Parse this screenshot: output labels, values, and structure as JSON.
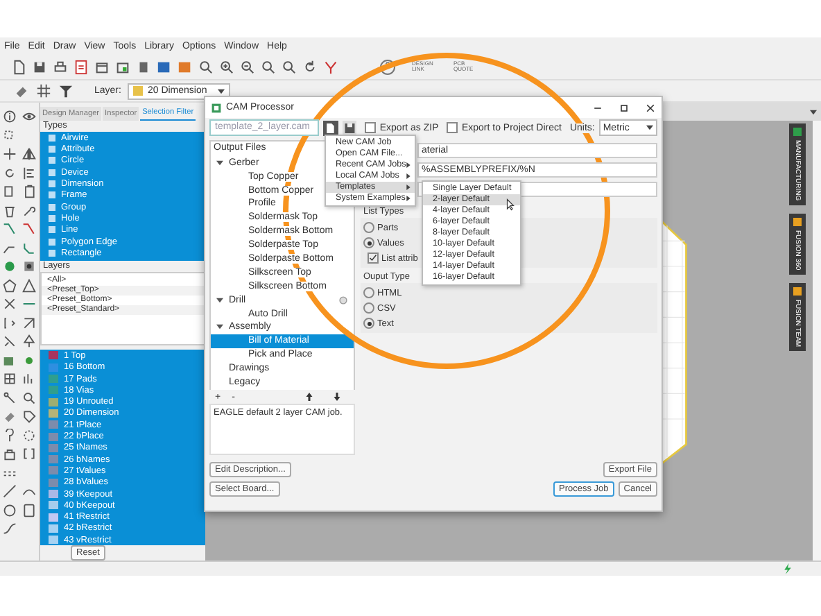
{
  "menu_bar": [
    "File",
    "Edit",
    "Draw",
    "View",
    "Tools",
    "Library",
    "Options",
    "Window",
    "Help"
  ],
  "toolbar": {
    "help": "?",
    "links": [
      "DESIGN LINK",
      "PCB QUOTE"
    ]
  },
  "layer_picker": {
    "label": "Layer:",
    "value": "20 Dimension"
  },
  "panel_tabs": [
    {
      "label": "Design Manager",
      "selected": false
    },
    {
      "label": "Inspector",
      "selected": false
    },
    {
      "label": "Selection Filter",
      "selected": true
    }
  ],
  "selection_filter": {
    "types_header": "Types",
    "types": [
      "Airwire",
      "Attribute",
      "Circle",
      "Device",
      "Dimension",
      "Frame",
      "Group",
      "Hole",
      "Line",
      "Polygon Edge",
      "Rectangle"
    ],
    "layers_header": "Layers",
    "presets": [
      "<All>",
      "<Preset_Top>",
      "<Preset_Bottom>",
      "<Preset_Standard>"
    ],
    "layers": [
      {
        "label": "1 Top",
        "color": "#a8345e"
      },
      {
        "label": "16 Bottom",
        "color": "#2e8fe0"
      },
      {
        "label": "17 Pads",
        "color": "#2f9e8e"
      },
      {
        "label": "18 Vias",
        "color": "#2f9e8e"
      },
      {
        "label": "19 Unrouted",
        "color": "#9cae72"
      },
      {
        "label": "20 Dimension",
        "color": "#b4b478"
      },
      {
        "label": "21 tPlace",
        "color": "#7c8cac"
      },
      {
        "label": "22 bPlace",
        "color": "#7c8cac"
      },
      {
        "label": "25 tNames",
        "color": "#7c8cac"
      },
      {
        "label": "26 bNames",
        "color": "#7c8cac"
      },
      {
        "label": "27 tValues",
        "color": "#7c8cac"
      },
      {
        "label": "28 bValues",
        "color": "#7c8cac"
      },
      {
        "label": "39 tKeepout",
        "color": "#aab8e6"
      },
      {
        "label": "40 bKeepout",
        "color": "#a6cdec"
      },
      {
        "label": "41 tRestrict",
        "color": "#c2c8f2"
      },
      {
        "label": "42 bRestrict",
        "color": "#a6d2f2"
      },
      {
        "label": "43 vRestrict",
        "color": "#a6d2f2"
      }
    ]
  },
  "reset_button": "Reset",
  "side_tabs": [
    {
      "label": "MANUFACTURING",
      "color": "#2e9e4a"
    },
    {
      "label": "FUSION 360",
      "color": "#e8a020"
    },
    {
      "label": "FUSION TEAM",
      "color": "#e8a020"
    }
  ],
  "cam_dialog": {
    "title": "CAM Processor",
    "job_file": "template_2_layer.cam",
    "export_zip": {
      "label": "Export as ZIP",
      "checked": false
    },
    "export_project": {
      "label": "Export to Project Direct",
      "checked": false
    },
    "units_label": "Units:",
    "units_value": "Metric",
    "tree_header": "Output Files",
    "tree": [
      {
        "label": "Gerber",
        "expanded": true,
        "selected": false,
        "children": [
          {
            "label": "Top Copper",
            "selected": false
          },
          {
            "label": "Bottom Copper",
            "selected": false
          },
          {
            "label": "Profile",
            "selected": false
          },
          {
            "label": "Soldermask Top",
            "selected": false
          },
          {
            "label": "Soldermask Bottom",
            "selected": false
          },
          {
            "label": "Solderpaste Top",
            "selected": false
          },
          {
            "label": "Solderpaste Bottom",
            "selected": false
          },
          {
            "label": "Silkscreen Top",
            "selected": false
          },
          {
            "label": "Silkscreen Bottom",
            "selected": false
          }
        ]
      },
      {
        "label": "Drill",
        "expanded": true,
        "selected": false,
        "children": [
          {
            "label": "Auto Drill",
            "selected": false
          }
        ]
      },
      {
        "label": "Assembly",
        "expanded": true,
        "selected": false,
        "children": [
          {
            "label": "Bill of Material",
            "selected": true
          },
          {
            "label": "Pick and Place",
            "selected": false
          }
        ]
      },
      {
        "label": "Drawings",
        "selected": false
      },
      {
        "label": "Legacy",
        "selected": false
      }
    ],
    "add_label": "+",
    "remove_label": "-",
    "description": "EAGLE default 2 layer CAM job.",
    "edit_description": "Edit Description...",
    "select_board": "Select Board...",
    "fields": [
      "aterial",
      "%ASSEMBLYPREFIX/%N"
    ],
    "list_types": {
      "title": "List Types",
      "options": [
        {
          "label": "Parts",
          "selected": false
        },
        {
          "label": "Values",
          "selected": true
        }
      ]
    },
    "list_attributes": {
      "label": "List attrib",
      "checked": true
    },
    "output_type": {
      "title": "Ouput Type",
      "options": [
        {
          "label": "HTML",
          "selected": false
        },
        {
          "label": "CSV",
          "selected": false
        },
        {
          "label": "Text",
          "selected": true
        }
      ]
    },
    "export_file": "Export File",
    "process_job": "Process Job",
    "cancel": "Cancel",
    "job_menu": [
      {
        "label": "New CAM Job",
        "submenu": false,
        "selected": false
      },
      {
        "label": "Open CAM File...",
        "submenu": false,
        "selected": false
      },
      {
        "label": "Recent CAM Jobs",
        "submenu": true,
        "selected": false
      },
      {
        "label": "Local CAM Jobs",
        "submenu": true,
        "selected": false
      },
      {
        "label": "Templates",
        "submenu": true,
        "selected": true
      },
      {
        "label": "System Examples",
        "submenu": true,
        "selected": false
      }
    ],
    "templates_menu": [
      {
        "label": "Single Layer Default",
        "selected": false
      },
      {
        "label": "2-layer Default",
        "selected": true
      },
      {
        "label": "4-layer Default",
        "selected": false
      },
      {
        "label": "6-layer Default",
        "selected": false
      },
      {
        "label": "8-layer Default",
        "selected": false
      },
      {
        "label": "10-layer Default",
        "selected": false
      },
      {
        "label": "12-layer Default",
        "selected": false
      },
      {
        "label": "14-layer Default",
        "selected": false
      },
      {
        "label": "16-layer Default",
        "selected": false
      }
    ]
  }
}
